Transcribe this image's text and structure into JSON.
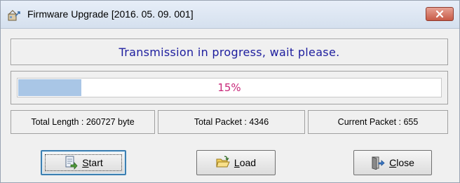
{
  "window": {
    "title": "Firmware Upgrade [2016. 05. 09. 001]"
  },
  "status": {
    "message": "Transmission in progress, wait please."
  },
  "progress": {
    "percent": 15,
    "label": "15%"
  },
  "stats": {
    "total_length": "Total Length : 260727 byte",
    "total_packet": "Total Packet : 4346",
    "current_packet": "Current Packet : 655"
  },
  "buttons": {
    "start": {
      "mnemonic": "S",
      "rest": "tart",
      "icon": "document-arrow-icon"
    },
    "load": {
      "mnemonic": "L",
      "rest": "oad",
      "icon": "folder-open-icon"
    },
    "close": {
      "mnemonic": "C",
      "rest": "lose",
      "icon": "exit-door-icon"
    }
  },
  "colors": {
    "status_text": "#1d1d9e",
    "progress_fill": "#a9c6e6",
    "progress_text": "#c8287a",
    "close_button": "#c75a46"
  }
}
